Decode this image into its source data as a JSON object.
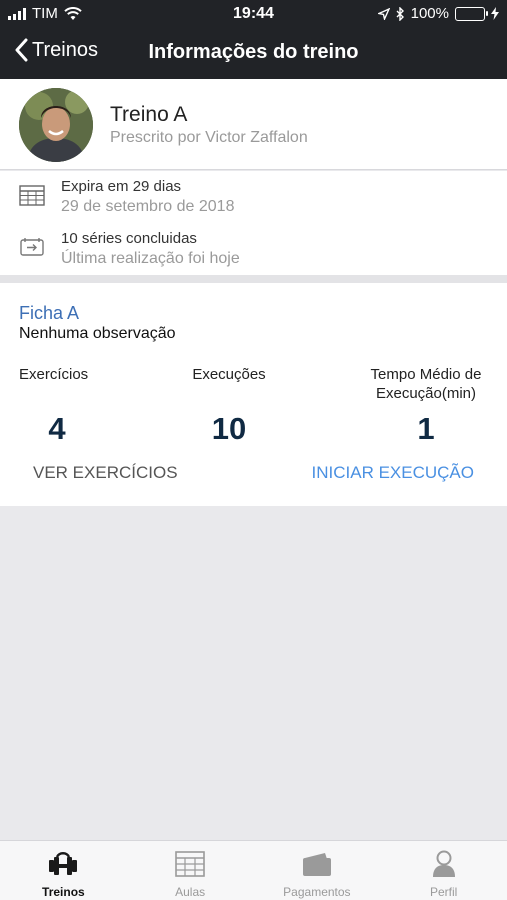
{
  "status": {
    "carrier": "TIM",
    "time": "19:44",
    "battery": "100%"
  },
  "nav": {
    "back_label": "Treinos",
    "title": "Informações do treino"
  },
  "profile": {
    "name": "Treino A",
    "subtitle": "Prescrito por Victor Zaffalon"
  },
  "info": [
    {
      "icon": "calendar-icon",
      "line1": "Expira em 29 dias",
      "line2": "29 de setembro de 2018"
    },
    {
      "icon": "ticket-icon",
      "line1": "10 séries concluidas",
      "line2": "Última realização foi hoje"
    }
  ],
  "ficha": {
    "title": "Ficha A",
    "observation": "Nenhuma observação",
    "stats": [
      {
        "label": "Exercícios",
        "value": "4"
      },
      {
        "label": "Execuções",
        "value": "10"
      },
      {
        "label_line1": "Tempo Médio de",
        "label_line2": "Execução(min)",
        "value": "1"
      }
    ],
    "ver_label": "VER EXERCÍCIOS",
    "iniciar_label": "INICIAR EXECUÇÃO"
  },
  "tabs": [
    {
      "label": "Treinos",
      "icon": "dumbbell-icon",
      "active": true
    },
    {
      "label": "Aulas",
      "icon": "grid-icon",
      "active": false
    },
    {
      "label": "Pagamentos",
      "icon": "wallet-icon",
      "active": false
    },
    {
      "label": "Perfil",
      "icon": "person-icon",
      "active": false
    }
  ],
  "colors": {
    "topbar": "#212327",
    "accent": "#4a90e2",
    "ficha_title": "#3d6fb5",
    "battery": "#4cd964"
  }
}
